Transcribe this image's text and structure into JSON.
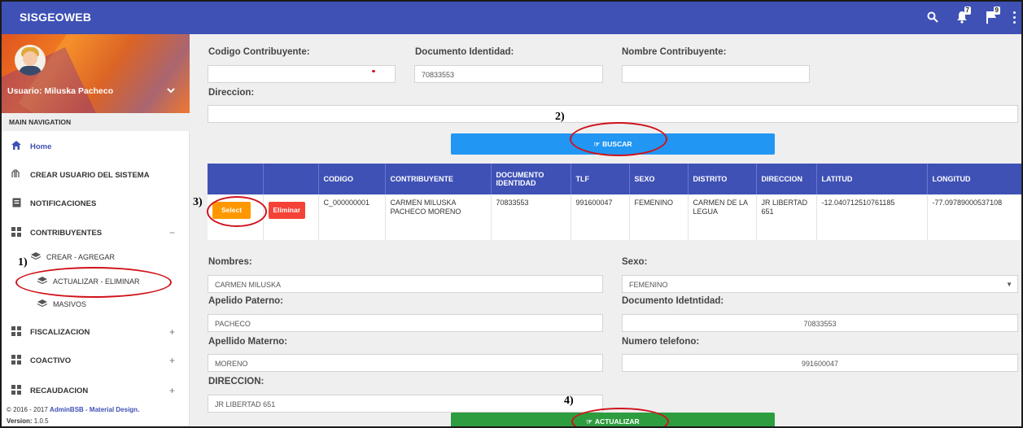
{
  "app": {
    "brand": "SISGEOWEB"
  },
  "topbar": {
    "icons": [
      "search-icon",
      "notifications-icon",
      "flag-icon",
      "more-vert-icon"
    ],
    "notif_badge": "7",
    "flag_badge": "9"
  },
  "sidebar": {
    "user_name": "Usuario: Miluska Pacheco",
    "nav_header": "MAIN NAVIGATION",
    "items": [
      {
        "label": "Home",
        "icon": "home-icon"
      },
      {
        "label": "CREAR USUARIO DEL SISTEMA",
        "icon": "user-add-icon"
      },
      {
        "label": "NOTIFICACIONES",
        "icon": "notifications-doc-icon"
      },
      {
        "label": "CONTRIBUYENTES",
        "icon": "grid-icon",
        "toggle": "−"
      },
      {
        "label": "FISCALIZACION",
        "icon": "grid-icon",
        "toggle": "+"
      },
      {
        "label": "COACTIVO",
        "icon": "grid-icon",
        "toggle": "+"
      },
      {
        "label": "RECAUDACION",
        "icon": "grid-icon",
        "toggle": "+"
      }
    ],
    "sub_items": [
      "CREAR - AGREGAR",
      "ACTUALIZAR - ELIMINAR",
      "MASIVOS"
    ],
    "footer_copy": "© 2016 - 2017 ",
    "footer_brand": "AdminBSB - Material Design.",
    "footer_version_label": "Version:",
    "footer_version": " 1.0.5"
  },
  "search_form": {
    "codigo_label": "Codigo Contribuyente:",
    "codigo_value": "",
    "documento_label": "Documento Identidad:",
    "documento_value": "70833553",
    "nombre_label": "Nombre Contribuyente:",
    "nombre_value": "",
    "direccion_label": "Direccion:",
    "direccion_value": "",
    "buscar_label": "BUSCAR"
  },
  "table": {
    "columns": [
      "",
      "",
      "CODIGO",
      "CONTRIBUYENTE",
      "DOCUMENTO IDENTIDAD",
      "TLF",
      "SEXO",
      "DISTRITO",
      "DIRECCION",
      "LATITUD",
      "LONGITUD"
    ],
    "select_label": "Select",
    "eliminar_label": "Eliminar",
    "rows": [
      {
        "codigo": "C_000000001",
        "contribuyente": "CARMEN MILUSKA PACHECO MORENO",
        "documento": "70833553",
        "tlf": "991600047",
        "sexo": "FEMENINO",
        "distrito": "CARMEN DE LA LEGUA",
        "direccion": "JR LIBERTAD 651",
        "latitud": "-12.040712510761185",
        "longitud": "-77.09789000537108"
      }
    ]
  },
  "edit_form": {
    "nombres_label": "Nombres:",
    "nombres_value": "CARMEN MILUSKA",
    "sexo_label": "Sexo:",
    "sexo_value": "FEMENINO",
    "paterno_label": "Apelido Paterno:",
    "paterno_value": "PACHECO",
    "doc_label": "Documento Idetntidad:",
    "doc_value": "70833553",
    "materno_label": "Apellido Materno:",
    "materno_value": "MORENO",
    "telefono_label": "Numero telefono:",
    "telefono_value": "991600047",
    "direccion_label": "DIRECCION:",
    "direccion_value": "JR LIBERTAD 651",
    "actualizar_label": "ACTUALIZAR"
  },
  "annotations": {
    "a1": "1)",
    "a2": "2)",
    "a3": "3)",
    "a4": "4)"
  },
  "colors": {
    "primary": "#3f51b5",
    "buscar": "#2196f3",
    "actualizar": "#2e9d3f",
    "select": "#ff9800",
    "eliminar": "#f44336",
    "annotation": "#d0121a"
  }
}
